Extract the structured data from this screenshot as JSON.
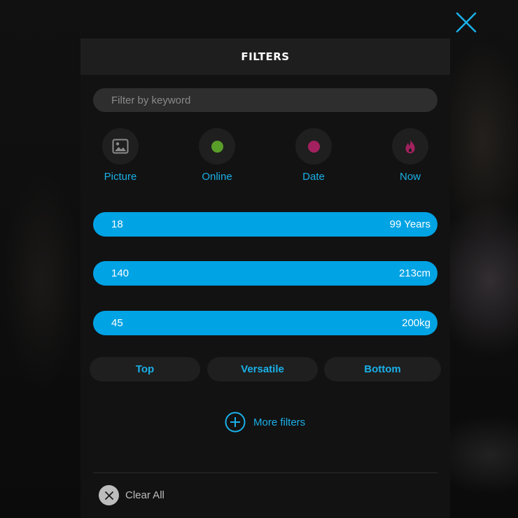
{
  "header": {
    "title": "FILTERS"
  },
  "close": {
    "icon": "close-icon",
    "color": "#1ab0e8"
  },
  "search": {
    "placeholder": "Filter by keyword",
    "value": ""
  },
  "quick_filters": [
    {
      "label": "Picture",
      "icon": "picture-icon",
      "color": "#8a8a8a"
    },
    {
      "label": "Online",
      "icon": "online-dot-icon",
      "color": "#5a9e2a"
    },
    {
      "label": "Date",
      "icon": "date-dot-icon",
      "color": "#a3215f"
    },
    {
      "label": "Now",
      "icon": "flame-icon",
      "color": "#a3215f"
    }
  ],
  "ranges": [
    {
      "name": "age",
      "min": "18",
      "max": "99 Years"
    },
    {
      "name": "height",
      "min": "140",
      "max": "213cm"
    },
    {
      "name": "weight",
      "min": "45",
      "max": "200kg"
    }
  ],
  "roles": [
    {
      "label": "Top"
    },
    {
      "label": "Versatile"
    },
    {
      "label": "Bottom"
    }
  ],
  "more_filters": {
    "label": "More filters",
    "icon": "plus-circle-icon"
  },
  "clear_all": {
    "label": "Clear All",
    "icon": "clear-icon"
  },
  "colors": {
    "accent": "#1ab0e8",
    "range_fill": "#00a3e4",
    "panel": "#121212",
    "header": "#1e1e1e"
  }
}
